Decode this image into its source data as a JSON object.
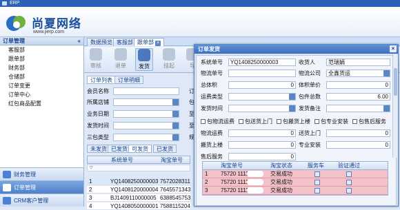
{
  "window": {
    "title": "ERP"
  },
  "brand": {
    "name": "尚夏网络",
    "url": "www.jierp.com"
  },
  "sidebar": {
    "header": "订单管理",
    "items": [
      "客服部",
      "跟单部",
      "财务部",
      "仓储部",
      "订单变更",
      "订单中心",
      "红包商品配置"
    ],
    "groups": [
      {
        "label": "财务管理",
        "active": false
      },
      {
        "label": "订单管理",
        "active": true
      },
      {
        "label": "CRM客户管理",
        "active": false
      }
    ]
  },
  "tabs": [
    "数据预览",
    "客服部",
    "跟单部"
  ],
  "toolbar": {
    "buttons": [
      {
        "label": "审核",
        "icon": "approve-icon",
        "enabled": false
      },
      {
        "label": "退单",
        "icon": "return-icon",
        "enabled": false
      },
      {
        "label": "发货",
        "icon": "truck-icon",
        "enabled": true
      },
      {
        "label": "挂起",
        "icon": "pause-icon",
        "enabled": false
      },
      {
        "label": "导",
        "icon": "export-icon",
        "enabled": false
      }
    ]
  },
  "subtabs": [
    "订单列表",
    "订单明细"
  ],
  "search": {
    "fields": [
      {
        "label": "会员名称",
        "value": "",
        "after": "订"
      },
      {
        "label": "所属店铺",
        "value": "",
        "after": "包"
      },
      {
        "label": "业务日期",
        "value": "",
        "after": "至"
      },
      {
        "label": "发货时间",
        "value": "",
        "after": "至"
      },
      {
        "label": "三包类型",
        "value": "",
        "after": "规"
      }
    ]
  },
  "status_tabs": [
    "未发货",
    "已发货",
    "可发货",
    "已发货"
  ],
  "order_grid": {
    "columns": [
      "系统单号",
      "淘宝单号"
    ],
    "filter_symbol": "▽",
    "rows": [
      {
        "idx": "1",
        "sys": "YQ1408250000003",
        "tb": "757202831111"
      },
      {
        "idx": "2",
        "sys": "YQ1408120000004",
        "tb": "76455713434"
      },
      {
        "idx": "3",
        "sys": "BJ1409110000005",
        "tb": "63885457535"
      },
      {
        "idx": "4",
        "sys": "YQ1408050000001",
        "tb": "75881152044"
      }
    ]
  },
  "dialog": {
    "title": "订单发货",
    "close": "×",
    "system_no_label": "系统单号",
    "system_no": "YQ1408250000003",
    "receiver_label": "收货人",
    "receiver": "范瑞娟",
    "tracking_label": "物流单号",
    "tracking": "",
    "carrier_label": "物流公司",
    "carrier": "全鑫货运",
    "total_volume_label": "总体积",
    "total_volume": "0",
    "volume_unit_label": "体积单价",
    "volume_unit": "0",
    "freight_type_label": "运费类型",
    "freight_type": "",
    "package_total_label": "包件总数",
    "package_total": "6.00",
    "ship_time_label": "发货时间",
    "ship_time": "",
    "ship_note_label": "发货备注",
    "ship_note": "",
    "checkboxes": [
      "包物流运费",
      "包送货上门",
      "包搬货上楼",
      "包专业安装",
      "包售后服务"
    ],
    "freight_label": "物流运费",
    "freight": "0",
    "delivery_label": "送货上门",
    "delivery": "0",
    "upstairs_label": "搬货上楼",
    "upstairs": "0",
    "install_label": "专业安装",
    "install": "0",
    "after_sales_label": "售后服务",
    "after_sales": "0",
    "grid": {
      "columns": [
        "淘宝单号",
        "淘宝状态",
        "服务车",
        "验证通过"
      ],
      "rows": [
        {
          "idx": "1",
          "tb": "75720  1111636",
          "status": "交易成功",
          "selected": true
        },
        {
          "idx": "2",
          "tb": "75720  1111636",
          "status": "交易成功",
          "selected": false
        },
        {
          "idx": "3",
          "tb": "75720  1111636",
          "status": "交易成功",
          "selected": false
        }
      ]
    }
  }
}
